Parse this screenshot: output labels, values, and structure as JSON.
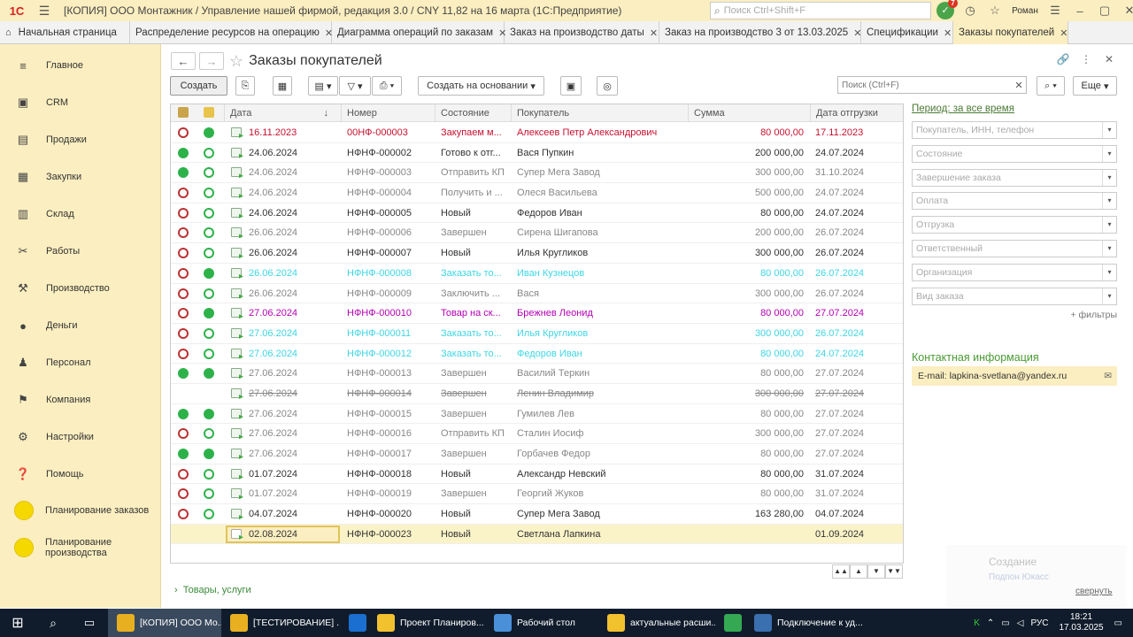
{
  "titlebar": {
    "logo": "1С",
    "window_title": "[КОПИЯ] ООО Монтажник / Управление нашей фирмой, редакция 3.0 / CNY 11,82 на 16 марта  (1С:Предприятие)",
    "search_placeholder": "Поиск Ctrl+Shift+F",
    "notifications_count": "7",
    "user": "Роман"
  },
  "tabs": [
    {
      "label": "Начальная страница"
    },
    {
      "label": "Распределение ресурсов на операцию"
    },
    {
      "label": "Диаграмма операций по заказам"
    },
    {
      "label": "Заказ на производство даты"
    },
    {
      "label": "Заказ на производство 3 от 13.03.2025"
    },
    {
      "label": "Спецификации"
    },
    {
      "label": "Заказы покупателей"
    }
  ],
  "sidebar": {
    "items": [
      {
        "label": "Главное",
        "icon": "list-icon"
      },
      {
        "label": "CRM",
        "icon": "crm-icon"
      },
      {
        "label": "Продажи",
        "icon": "sales-icon"
      },
      {
        "label": "Закупки",
        "icon": "purchases-icon"
      },
      {
        "label": "Склад",
        "icon": "warehouse-icon"
      },
      {
        "label": "Работы",
        "icon": "works-icon"
      },
      {
        "label": "Производство",
        "icon": "production-icon"
      },
      {
        "label": "Деньги",
        "icon": "money-icon"
      },
      {
        "label": "Персонал",
        "icon": "staff-icon"
      },
      {
        "label": "Компания",
        "icon": "company-icon"
      },
      {
        "label": "Настройки",
        "icon": "gear-icon"
      },
      {
        "label": "Помощь",
        "icon": "help-icon"
      }
    ],
    "extra": [
      {
        "label": "Планирование заказов"
      },
      {
        "label": "Планирование производства"
      }
    ]
  },
  "page": {
    "title": "Заказы покупателей"
  },
  "toolbar": {
    "create": "Создать",
    "create_based": "Создать на основании",
    "search_placeholder": "Поиск (Ctrl+F)",
    "more": "Еще"
  },
  "grid": {
    "columns": {
      "date": "Дата",
      "number": "Номер",
      "state": "Состояние",
      "customer": "Покупатель",
      "sum": "Сумма",
      "ship_date": "Дата отгрузки"
    },
    "rows": [
      {
        "s1": "r",
        "s2": "g",
        "date": "16.11.2023",
        "number": "00НФ-000003",
        "state": "Закупаем м...",
        "customer": "Алексеев Петр Александрович",
        "sum": "80 000,00",
        "ship": "17.11.2023",
        "color": "#c8102e"
      },
      {
        "s1": "g",
        "s2": "go",
        "date": "24.06.2024",
        "number": "НФНФ-000002",
        "state": "Готово к отг...",
        "customer": "Вася Пупкин",
        "sum": "200 000,00",
        "ship": "24.07.2024",
        "color": "#333"
      },
      {
        "s1": "g",
        "s2": "go",
        "date": "24.06.2024",
        "number": "НФНФ-000003",
        "state": "Отправить КП",
        "customer": "Супер Мега Завод",
        "sum": "300 000,00",
        "ship": "31.10.2024",
        "color": "#888"
      },
      {
        "s1": "r",
        "s2": "go",
        "date": "24.06.2024",
        "number": "НФНФ-000004",
        "state": "Получить и ...",
        "customer": "Олеся Васильева",
        "sum": "500 000,00",
        "ship": "24.07.2024",
        "color": "#888"
      },
      {
        "s1": "r",
        "s2": "go",
        "date": "24.06.2024",
        "number": "НФНФ-000005",
        "state": "Новый",
        "customer": "Федоров Иван",
        "sum": "80 000,00",
        "ship": "24.07.2024",
        "color": "#333"
      },
      {
        "s1": "r",
        "s2": "go",
        "date": "26.06.2024",
        "number": "НФНФ-000006",
        "state": "Завершен",
        "customer": "Сирена Шигапова",
        "sum": "200 000,00",
        "ship": "26.07.2024",
        "color": "#888"
      },
      {
        "s1": "r",
        "s2": "go",
        "date": "26.06.2024",
        "number": "НФНФ-000007",
        "state": "Новый",
        "customer": "Илья Кругликов",
        "sum": "300 000,00",
        "ship": "26.07.2024",
        "color": "#333"
      },
      {
        "s1": "r",
        "s2": "g",
        "date": "26.06.2024",
        "number": "НФНФ-000008",
        "state": "Заказать то...",
        "customer": "Иван Кузнецов",
        "sum": "80 000,00",
        "ship": "26.07.2024",
        "color": "#3ed6e6"
      },
      {
        "s1": "r",
        "s2": "go",
        "date": "26.06.2024",
        "number": "НФНФ-000009",
        "state": "Заключить ...",
        "customer": "Вася",
        "sum": "300 000,00",
        "ship": "26.07.2024",
        "color": "#888"
      },
      {
        "s1": "r",
        "s2": "g",
        "date": "27.06.2024",
        "number": "НФНФ-000010",
        "state": "Товар на ск...",
        "customer": "Брежнев Леонид",
        "sum": "80 000,00",
        "ship": "27.07.2024",
        "color": "#b300b3"
      },
      {
        "s1": "r",
        "s2": "go",
        "date": "27.06.2024",
        "number": "НФНФ-000011",
        "state": "Заказать то...",
        "customer": "Илья Кругликов",
        "sum": "300 000,00",
        "ship": "26.07.2024",
        "color": "#3ed6e6"
      },
      {
        "s1": "r",
        "s2": "go",
        "date": "27.06.2024",
        "number": "НФНФ-000012",
        "state": "Заказать то...",
        "customer": "Федоров Иван",
        "sum": "80 000,00",
        "ship": "24.07.2024",
        "color": "#3ed6e6"
      },
      {
        "s1": "g",
        "s2": "g",
        "date": "27.06.2024",
        "number": "НФНФ-000013",
        "state": "Завершен",
        "customer": "Василий Теркин",
        "sum": "80 000,00",
        "ship": "27.07.2024",
        "color": "#888"
      },
      {
        "s1": "",
        "s2": "",
        "date": "27.06.2024",
        "number": "НФНФ-000014",
        "state": "Завершен",
        "customer": "Ленин Владимир",
        "sum": "300 000,00",
        "ship": "27.07.2024",
        "color": "#888",
        "strike": true
      },
      {
        "s1": "g",
        "s2": "g",
        "date": "27.06.2024",
        "number": "НФНФ-000015",
        "state": "Завершен",
        "customer": "Гумилев Лев",
        "sum": "80 000,00",
        "ship": "27.07.2024",
        "color": "#888"
      },
      {
        "s1": "r",
        "s2": "go",
        "date": "27.06.2024",
        "number": "НФНФ-000016",
        "state": "Отправить КП",
        "customer": "Сталин Иосиф",
        "sum": "300 000,00",
        "ship": "27.07.2024",
        "color": "#888"
      },
      {
        "s1": "g",
        "s2": "g",
        "date": "27.06.2024",
        "number": "НФНФ-000017",
        "state": "Завершен",
        "customer": "Горбачев Федор",
        "sum": "80 000,00",
        "ship": "27.07.2024",
        "color": "#888"
      },
      {
        "s1": "r",
        "s2": "go",
        "date": "01.07.2024",
        "number": "НФНФ-000018",
        "state": "Новый",
        "customer": "Александр Невский",
        "sum": "80 000,00",
        "ship": "31.07.2024",
        "color": "#333"
      },
      {
        "s1": "r",
        "s2": "go",
        "date": "01.07.2024",
        "number": "НФНФ-000019",
        "state": "Завершен",
        "customer": "Георгий Жуков",
        "sum": "80 000,00",
        "ship": "31.07.2024",
        "color": "#888"
      },
      {
        "s1": "r",
        "s2": "go",
        "date": "04.07.2024",
        "number": "НФНФ-000020",
        "state": "Новый",
        "customer": "Супер Мега Завод",
        "sum": "163 280,00",
        "ship": "04.07.2024",
        "color": "#333"
      },
      {
        "s1": "",
        "s2": "",
        "date": "02.08.2024",
        "number": "НФНФ-000023",
        "state": "Новый",
        "customer": "Светлана Лапкина",
        "sum": "",
        "ship": "01.09.2024",
        "color": "#333",
        "selected": true
      }
    ]
  },
  "filters": {
    "period": "Период: за все время",
    "fields": [
      "Покупатель, ИНН, телефон",
      "Состояние",
      "Завершение заказа",
      "Оплата",
      "Отгрузка",
      "Ответственный",
      "Организация",
      "Вид заказа"
    ],
    "more": "+ фильтры"
  },
  "contact": {
    "title": "Контактная информация",
    "email": "E-mail: lapkina-svetlana@yandex.ru"
  },
  "bottom": {
    "goods": "Товары, услуги",
    "collapse": "свернуть",
    "toast_title": "Создание",
    "toast_sub": "Подпон Юкасс"
  },
  "taskbar": {
    "items": [
      {
        "label": "[КОПИЯ] ООО Мо...",
        "color": "#e8b020"
      },
      {
        "label": "[ТЕСТИРОВАНИЕ] ...",
        "color": "#e8b020"
      },
      {
        "label": "",
        "color": "#1b6fd0"
      },
      {
        "label": "Проект Планиров...",
        "color": "#f2c12e"
      },
      {
        "label": "Рабочий стол",
        "color": "#4a90d9"
      },
      {
        "label": "актуальные расши...",
        "color": "#f2c12e"
      },
      {
        "label": "",
        "color": "#34a853"
      },
      {
        "label": "Подключение к уд...",
        "color": "#3a6fb0"
      }
    ],
    "lang": "РУС",
    "time": "18:21",
    "date": "17.03.2025"
  }
}
